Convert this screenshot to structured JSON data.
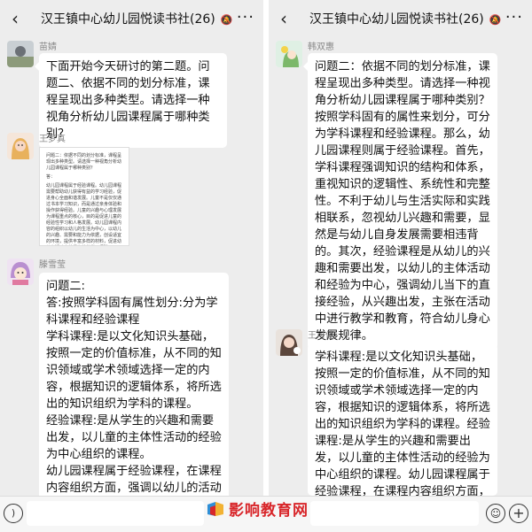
{
  "left": {
    "title": "汉王镇中心幼儿园悦读书社(26)",
    "bell": "🔕",
    "messages": [
      {
        "sender": "苗婧",
        "text": "下面开始今天研讨的第二题。问题二、依据不同的划分标准，课程呈现出多种类型。请选择一种视角分析幼儿园课程属于哪种类别？"
      },
      {
        "sender": "王梦真",
        "image_text": [
          "问题二：依据不同的划分标准，课程呈现出多种类型。请选择一种视角分析幼儿园课程属于哪种类别？",
          "答：",
          "幼儿园课程属于经验课程。幼儿园课程需要帮助幼儿获得有益的学习经验，促进身心全面和谐发展。儿童不是仅仅通过书本学习知识，而是通过亲身体验和操作获得经验。儿童的兴趣与心理发展为课程重点的核心，目的是促进儿童的经验性学习和人格发展。幼儿园课程内容的组织以幼儿的生活为中心，以幼儿的兴趣、需要和能力为依据，创设适宜的环境，提供丰富多样的材料，促进幼儿在活动中获得有益的学习经验。"
        ]
      },
      {
        "sender": "滕雪莹",
        "lines": [
          "问题二:",
          "答:按照学科固有属性划分:分为学科课程和经验课程",
          "学科课程:是以文化知识头基础，按照一定的价值标准，从不同的知识领域或学术领域选择一定的内容，根据知识的逻辑体系，将所选出的知识组织为学科的课程。",
          "经验课程:是从学生的兴趣和需要出发，以儿童的主体性活动的经验为中心组织的课程。",
          "幼儿园课程属于经验课程，在课程内容组织方面，强调以幼儿的活动为中心，以幼儿的兴趣、需要和能"
        ]
      }
    ]
  },
  "right": {
    "title": "汉王镇中心幼儿园悦读书社(26)",
    "messages": [
      {
        "sender": "韩双惠",
        "text": "问题二：依据不同的划分标准，课程呈现出多种类型。请选择一种视角分析幼儿园课程属于哪种类别？按照学科固有的属性来划分，可分为学科课程和经验课程。那么，幼儿园课程则属于经验课程。首先，学科课程强调知识的结构和体系，重视知识的逻辑性、系统性和完整性。不利于幼儿与生活实际和实践相联系，忽视幼儿兴趣和需要，显然是与幼儿自身发展需要相违背的。其次，经验课程是从幼儿的兴趣和需要出发，以幼儿的主体活动和经验为中心，强调幼儿当下的直接经验，从兴趣出发，主张在活动中进行教学和教育，符合幼儿身心发展规律。"
      },
      {
        "sender": "王可僖",
        "text": "学科课程:是以文化知识头基础，按照一定的价值标准，从不同的知识领域或学术领域选择一定的内容，根据知识的逻辑体系，将所选出的知识组织为学科的课程。经验课程:是从学生的兴趣和需要出发，以儿童的主体性活动的经验为中心组织的课程。幼儿园课程属于经验课程，在课程内容组织方面，强调以幼儿的活动为中心，以幼儿的兴趣、需要和能力为依据"
      }
    ]
  },
  "watermark": {
    "text": "影响教育网"
  },
  "colors": {
    "bg": "#ededed",
    "bubble": "#ffffff",
    "watermark": "#d8262a"
  },
  "icons": [
    "back-icon",
    "bell-muted-icon",
    "more-icon",
    "voice-icon",
    "emoji-icon",
    "plus-icon"
  ]
}
